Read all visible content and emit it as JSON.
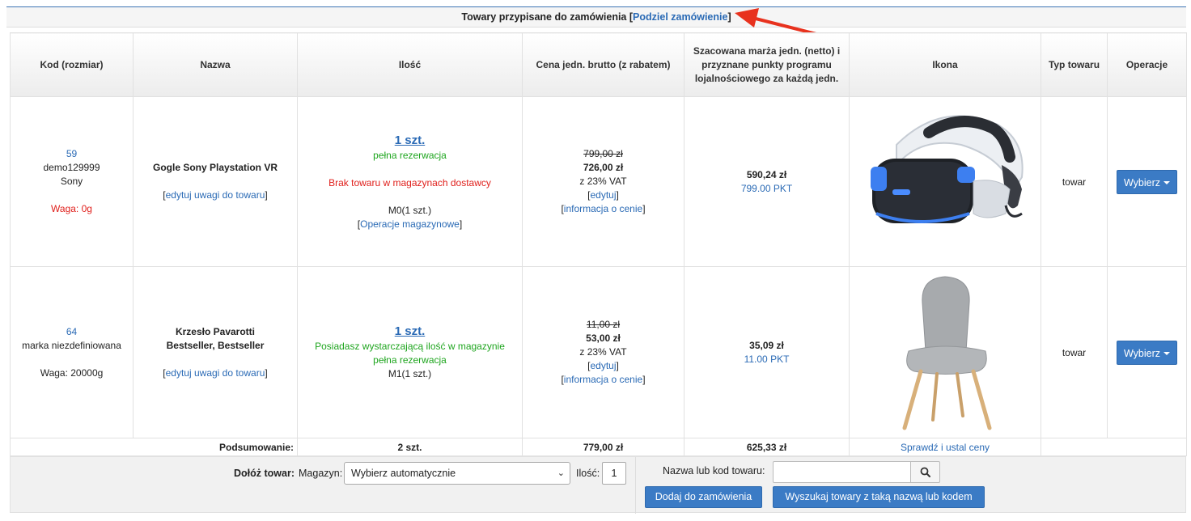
{
  "section": {
    "title": "Towary przypisane do zamówienia",
    "split_link": "Podziel zamówienie",
    "bracket_open": "[",
    "bracket_close": "]"
  },
  "columns": [
    "Kod (rozmiar)",
    "Nazwa",
    "Ilość",
    "Cena jedn. brutto (z rabatem)",
    "Szacowana marża jedn. (netto) i przyznane punkty programu lojalnościowego za każdą jedn.",
    "Ikona",
    "Typ towaru",
    "Operacje"
  ],
  "rows": [
    {
      "code_id": "59",
      "code": "demo129999",
      "brand": "Sony",
      "weight": "Waga: 0g",
      "name_lines": [
        "Gogle Sony Playstation VR"
      ],
      "edit_notes": "edytuj uwagi do towaru",
      "qty": "1 szt.",
      "qty_status": [
        "pełna rezerwacja"
      ],
      "stock_warning": "Brak towaru w magazynach dostawcy",
      "warehouse": "M0(1 szt.)",
      "warehouse_ops": "Operacje magazynowe",
      "old_price": "799,00 zł",
      "price": "726,00 zł",
      "vat": "z 23% VAT",
      "edit": "edytuj",
      "price_info": "informacja o cenie",
      "margin": "590,24 zł",
      "points": "799.00 PKT",
      "icon": "vr-headset-image",
      "type": "towar",
      "op_button": "Wybierz"
    },
    {
      "code_id": "64",
      "code": "marka niezdefiniowana",
      "weight": "Waga: 20000g",
      "name_lines": [
        "Krzesło Pavarotti",
        "Bestseller, Bestseller"
      ],
      "edit_notes": "edytuj uwagi do towaru",
      "qty": "1 szt.",
      "qty_status": [
        "Posiadasz wystarczającą ilość w magazynie",
        "pełna rezerwacja"
      ],
      "warehouse": "M1(1 szt.)",
      "old_price": "11,00 zł",
      "price": "53,00 zł",
      "vat": "z 23% VAT",
      "edit": "edytuj",
      "price_info": "informacja o cenie",
      "margin": "35,09 zł",
      "points": "11.00 PKT",
      "icon": "chair-image",
      "type": "towar",
      "op_button": "Wybierz"
    }
  ],
  "summary": {
    "label": "Podsumowanie:",
    "qty": "2 szt.",
    "price": "779,00 zł",
    "margin": "625,33 zł",
    "check_link": "Sprawdź i ustal ceny"
  },
  "add_item": {
    "label": "Dołóż towar:",
    "warehouse_label": "Magazyn:",
    "warehouse_value": "Wybierz automatycznie",
    "qty_label": "Ilość:",
    "qty_value": "1",
    "search_label": "Nazwa lub kod towaru:",
    "search_value": "",
    "add_button": "Dodaj do zamówienia",
    "search_button": "Wyszukaj towary z taką nazwą lub kodem"
  },
  "colors": {
    "accent_blue": "#2a6ab5",
    "button_blue": "#3b7bc5",
    "red": "#e0201c",
    "green": "#1ea51e",
    "arrow_red": "#e8321e"
  }
}
